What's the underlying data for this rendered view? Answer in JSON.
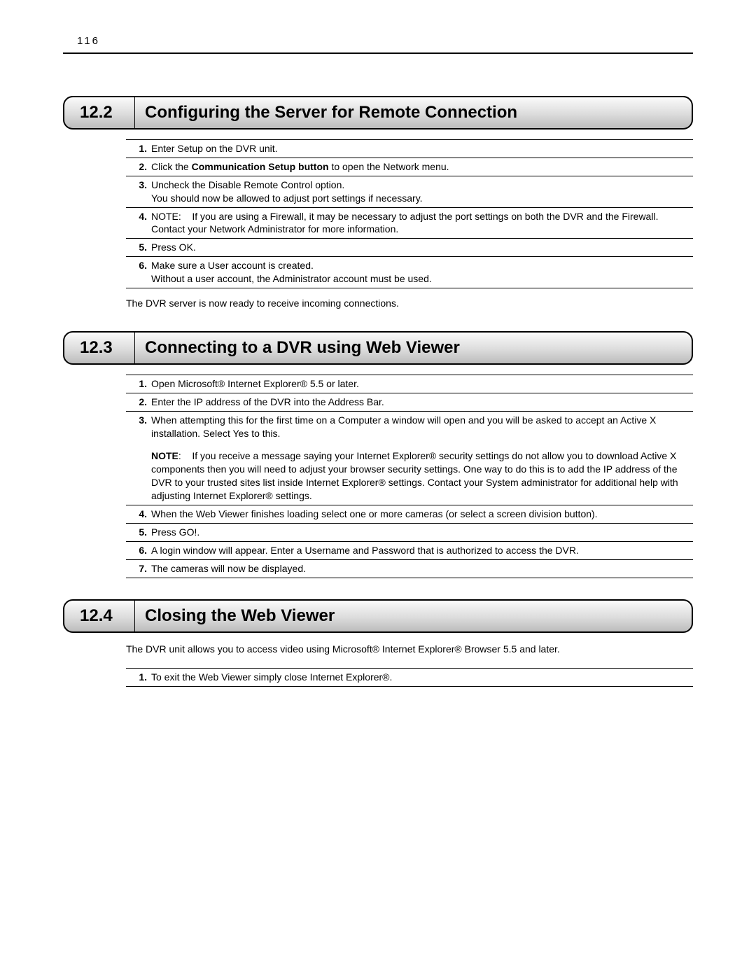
{
  "page_number": "116",
  "sections": [
    {
      "number": "12.2",
      "title": "Configuring the Server for Remote Connection",
      "steps": [
        {
          "n": "1.",
          "html": "Enter Setup on the DVR unit."
        },
        {
          "n": "2.",
          "html": "Click the <b>Communication Setup button</b> to open the Network menu."
        },
        {
          "n": "3.",
          "html": "Uncheck the Disable Remote Control option.<br>You should now be allowed to adjust port settings if necessary."
        },
        {
          "n": "4.",
          "html": "NOTE: &nbsp;&nbsp; If you are using a Firewall, it may be necessary to adjust the port settings on both the DVR and the Firewall.  Contact your Network Administrator for more information."
        },
        {
          "n": "5.",
          "html": "Press OK."
        },
        {
          "n": "6.",
          "html": "Make sure a User account is created.<br>Without a user account, the Administrator account must be used."
        }
      ],
      "after": "The DVR server is now ready to receive incoming connections."
    },
    {
      "number": "12.3",
      "title": "Connecting to a DVR using Web Viewer",
      "steps": [
        {
          "n": "1.",
          "html": "Open Microsoft® Internet Explorer® 5.5 or later."
        },
        {
          "n": "2.",
          "html": "Enter the IP address of the DVR into the Address Bar."
        },
        {
          "n": "3.",
          "html": "When attempting this for the first time on a Computer a window will open and you will be asked to accept an Active X installation. Select Yes to this.<div class=\"sub-note\"><b>NOTE</b>: &nbsp;&nbsp; If you receive a message saying your Internet Explorer® security settings do not allow you to download Active X components then you will need to adjust your browser security settings. One way to do this is to add the IP address of the DVR to your trusted sites list inside Internet Explorer® settings. Contact your System administrator for additional help with adjusting Internet Explorer® settings.</div>"
        },
        {
          "n": "4.",
          "html": "When the Web Viewer finishes loading select one or more cameras (or select a screen division button)."
        },
        {
          "n": "5.",
          "html": "Press GO!."
        },
        {
          "n": "6.",
          "html": "A login window will appear. Enter a Username and Password that is authorized to access the DVR."
        },
        {
          "n": "7.",
          "html": "The cameras will now be displayed."
        }
      ]
    },
    {
      "number": "12.4",
      "title": "Closing the Web Viewer",
      "before": "The DVR unit allows you to access video using Microsoft® Internet Explorer® Browser 5.5 and later.",
      "steps": [
        {
          "n": "1.",
          "html": "To exit the Web Viewer simply close Internet Explorer®."
        }
      ]
    }
  ]
}
